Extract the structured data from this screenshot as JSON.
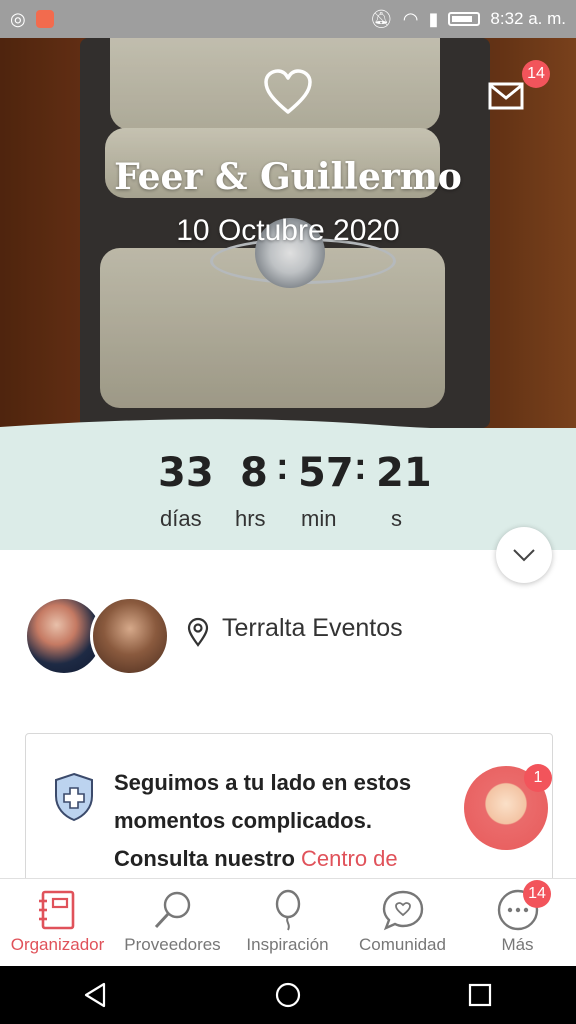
{
  "status_bar": {
    "time": "8:32 a. m.",
    "left_icons": [
      "whatsapp-icon",
      "app-notification-icon"
    ],
    "right_icons": [
      "mute-icon",
      "wifi-icon",
      "signal-icon",
      "battery-icon"
    ]
  },
  "hero": {
    "couple_names": "Feer & Guillermo",
    "wedding_date": "10 Octubre 2020",
    "mail_badge_count": "14"
  },
  "countdown": {
    "days": "33",
    "days_label": "días",
    "hours": "8",
    "hours_label": "hrs",
    "minutes": "57",
    "minutes_label": "min",
    "seconds": "21",
    "seconds_label": "s",
    "separator": ":"
  },
  "venue": {
    "name": "Terralta Eventos"
  },
  "card": {
    "message": "Seguimos a tu lado en estos momentos complicados. Consulta nuestro ",
    "link_text": "Centro de",
    "helper_badge": "1"
  },
  "bottom_nav": {
    "items": [
      {
        "label": "Organizador",
        "icon": "planner-icon",
        "active": true
      },
      {
        "label": "Proveedores",
        "icon": "search-icon",
        "active": false
      },
      {
        "label": "Inspiración",
        "icon": "balloon-icon",
        "active": false
      },
      {
        "label": "Comunidad",
        "icon": "chat-heart-icon",
        "active": false
      },
      {
        "label": "Más",
        "icon": "more-icon",
        "active": false
      }
    ],
    "more_badge": "14"
  },
  "colors": {
    "accent": "#e0525a",
    "countdown_bg": "#dcece8",
    "badge": "#f2545b"
  }
}
